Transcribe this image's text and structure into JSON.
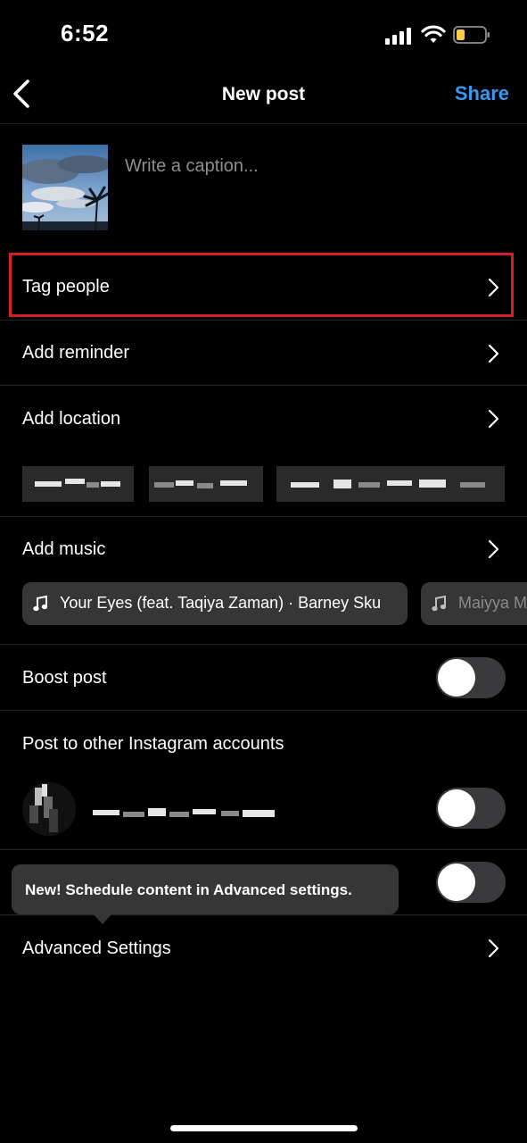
{
  "status_bar": {
    "time": "6:52",
    "battery_color": "#f7ce46"
  },
  "header": {
    "title": "New post",
    "share_label": "Share",
    "accent": "#3897f0"
  },
  "caption": {
    "placeholder": "Write a caption..."
  },
  "rows": {
    "tag_people": "Tag people",
    "add_reminder": "Add reminder",
    "add_location": "Add location",
    "add_music": "Add music",
    "boost_post": "Boost post",
    "post_to_other": "Post to other Instagram accounts",
    "advanced_settings": "Advanced Settings"
  },
  "music": {
    "suggestions": [
      "Your Eyes (feat. Taqiya Zaman) · Barney Sku",
      "Maiyya M"
    ]
  },
  "toggles": {
    "boost_post": false,
    "other_account": false,
    "row_behind_tooltip": false
  },
  "tooltip": {
    "text": "New! Schedule content in Advanced settings."
  },
  "highlight_color": "#d3202b"
}
